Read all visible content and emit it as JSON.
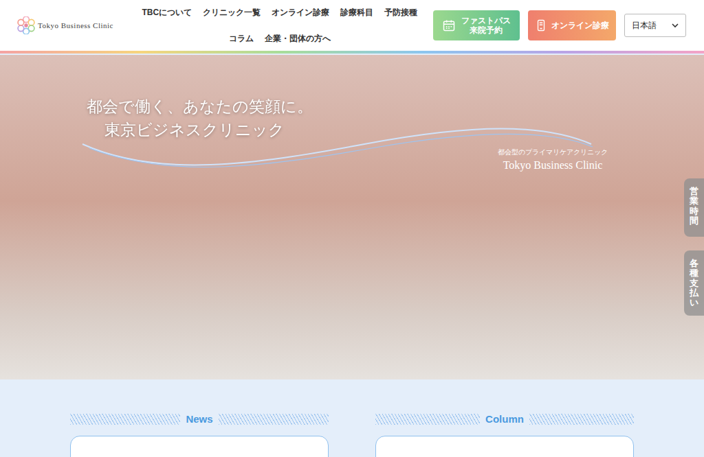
{
  "header": {
    "logo": "Tokyo Business Clinic",
    "nav": [
      "TBCについて",
      "クリニック一覧",
      "オンライン診療",
      "診療科目",
      "予防接種",
      "コラム",
      "企業・団体の方へ"
    ],
    "fastpass": [
      "ファストパス",
      "来院予約"
    ],
    "online": "オンライン診療",
    "language": "日本語"
  },
  "hero": {
    "tagline": [
      "都会で働く、あなたの笑顔に。",
      "東京ビジネスクリニック"
    ],
    "subtitle": "都会型のプライマリケアクリニック",
    "name": "Tokyo Business Clinic"
  },
  "side_tabs": [
    "営業時間",
    "各種支払い"
  ],
  "sections": [
    {
      "title": "News"
    },
    {
      "title": "Column"
    }
  ]
}
